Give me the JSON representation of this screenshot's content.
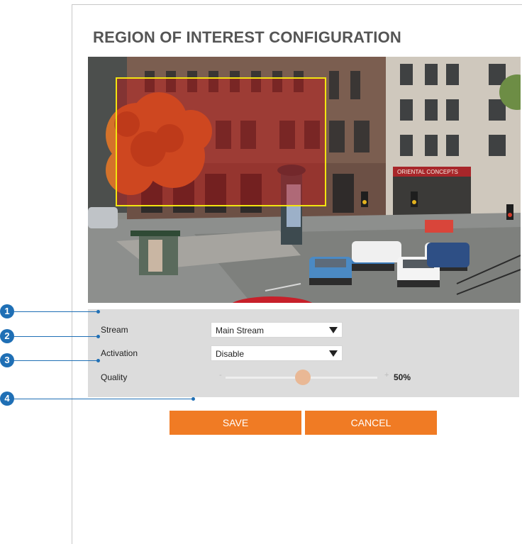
{
  "title": "REGION OF INTEREST CONFIGURATION",
  "video": {
    "roi_color": "#f2e411",
    "roi_fill": "#c81414",
    "sign_text": "ORIENTAL CONCEPTS"
  },
  "settings": {
    "stream": {
      "label": "Stream",
      "value": "Main Stream"
    },
    "activation": {
      "label": "Activation",
      "value": "Disable"
    },
    "quality": {
      "label": "Quality",
      "min_symbol": "-",
      "max_symbol": "+",
      "value_label": "50%",
      "level": 0.5
    }
  },
  "buttons": {
    "save": "SAVE",
    "cancel": "CANCEL"
  },
  "callouts": [
    "1",
    "2",
    "3",
    "4"
  ],
  "colors": {
    "accent": "#f07b24",
    "callout": "#1f6fb5",
    "panel": "#dcdcdc"
  }
}
